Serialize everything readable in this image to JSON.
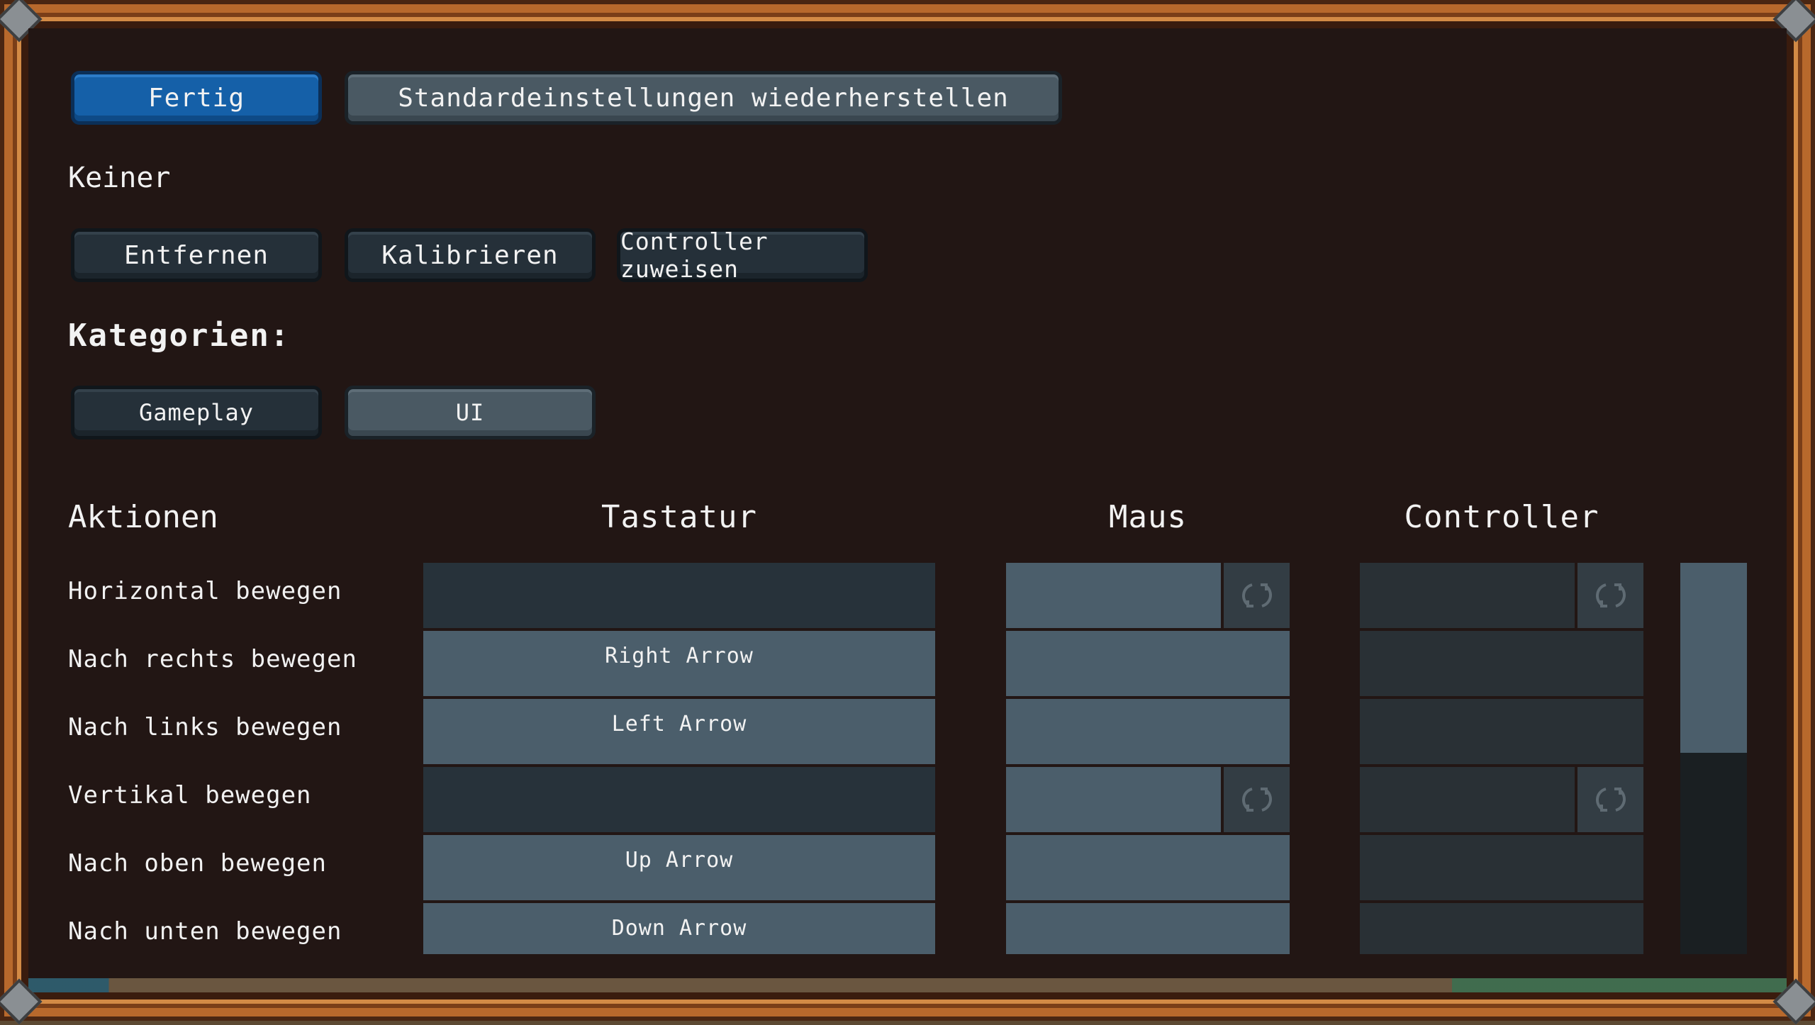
{
  "toolbar": {
    "done_label": "Fertig",
    "restore_label": "Standardeinstellungen wiederherstellen"
  },
  "controller_section": {
    "device_name": "Keiner",
    "remove_label": "Entfernen",
    "calibrate_label": "Kalibrieren",
    "assign_label": "Controller zuweisen"
  },
  "categories": {
    "heading": "Kategorien:",
    "gameplay_label": "Gameplay",
    "ui_label": "UI",
    "selected": "UI"
  },
  "table": {
    "headers": {
      "actions": "Aktionen",
      "keyboard": "Tastatur",
      "mouse": "Maus",
      "controller": "Controller"
    },
    "rows": [
      {
        "action": "Horizontal bewegen",
        "keyboard": "",
        "mouse": "",
        "controller": ""
      },
      {
        "action": "Nach rechts bewegen",
        "keyboard": "Right Arrow",
        "mouse": "",
        "controller": ""
      },
      {
        "action": "Nach links bewegen",
        "keyboard": "Left Arrow",
        "mouse": "",
        "controller": ""
      },
      {
        "action": "Vertikal bewegen",
        "keyboard": "",
        "mouse": "",
        "controller": ""
      },
      {
        "action": "Nach oben bewegen",
        "keyboard": "Up Arrow",
        "mouse": "",
        "controller": ""
      },
      {
        "action": "Nach unten bewegen",
        "keyboard": "Down Arrow",
        "mouse": "",
        "controller": ""
      }
    ]
  },
  "icons": {
    "axis_refresh": "refresh-icon"
  },
  "colors": {
    "accent": "#1560a8",
    "panel_bg": "#221614",
    "frame": "#b8692c"
  }
}
